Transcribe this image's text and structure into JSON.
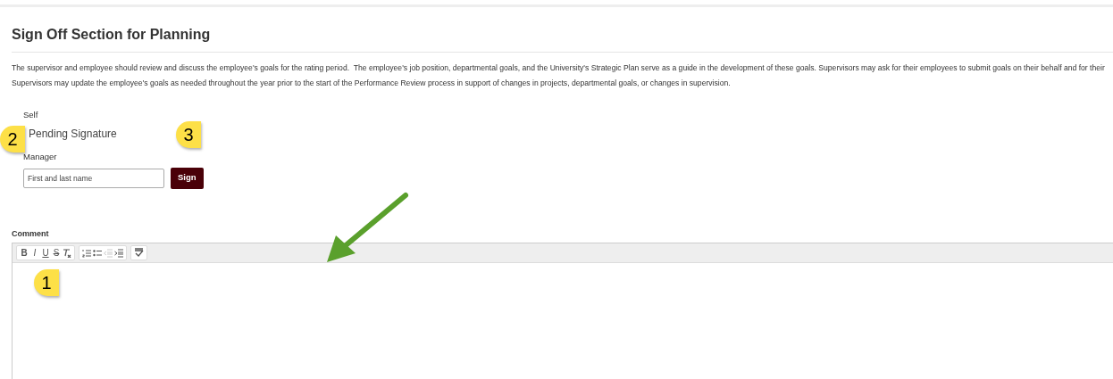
{
  "title": "Sign Off Section for Planning",
  "description_lines": [
    "The supervisor and employee should review and discuss the employee's goals for the rating period.  The employee's job position, departmental goals, and the University's Strategic Plan serve as a guide in the development of these goals. Supervisors may ask for their employees to submit goals on their behalf and for their",
    "Supervisors may update the employee's goals as needed throughout the year prior to the start of the Performance Review process in support of changes in projects, departmental goals, or changes in supervision."
  ],
  "self": {
    "label": "Self",
    "status": "Pending Signature"
  },
  "manager": {
    "label": "Manager",
    "placeholder": "First and last name",
    "button": "Sign"
  },
  "comment": {
    "label": "Comment",
    "toolbar_groups": [
      [
        {
          "kind": "bold",
          "text": "B",
          "disabled": false
        },
        {
          "kind": "italic",
          "text": "I",
          "disabled": false
        },
        {
          "kind": "underline",
          "text": "U",
          "disabled": false
        },
        {
          "kind": "strike",
          "text": "S",
          "disabled": false
        },
        {
          "kind": "clear-format",
          "disabled": false
        }
      ],
      [
        {
          "kind": "numbered-list",
          "disabled": false
        },
        {
          "kind": "bullet-list",
          "disabled": false
        },
        {
          "kind": "outdent",
          "disabled": true
        },
        {
          "kind": "indent",
          "disabled": false
        }
      ],
      [
        {
          "kind": "spellcheck",
          "disabled": false
        }
      ]
    ]
  },
  "callouts": [
    "1",
    "2",
    "3"
  ]
}
